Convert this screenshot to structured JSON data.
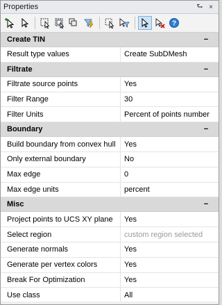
{
  "window": {
    "title": "Properties",
    "pin_glyph": "⮑",
    "close_glyph": "×"
  },
  "toolbar": {
    "tools": [
      {
        "name": "add-select-icon"
      },
      {
        "name": "select-icon"
      },
      {
        "name": "select-window-icon"
      },
      {
        "name": "select-crossing-icon"
      },
      {
        "name": "quick-select-icon"
      },
      {
        "name": "lightning-filter-icon"
      },
      {
        "name": "pick-move-icon"
      },
      {
        "name": "pick-filter-icon"
      },
      {
        "name": "pick-cursor-icon",
        "active": true
      },
      {
        "name": "deselect-icon"
      },
      {
        "name": "help-icon"
      }
    ]
  },
  "sections": [
    {
      "name": "Create TIN",
      "collapse": "−",
      "rows": [
        {
          "label": "Result type values",
          "value": "Create SubDMesh"
        }
      ]
    },
    {
      "name": "Filtrate",
      "collapse": "−",
      "rows": [
        {
          "label": "Filtrate source points",
          "value": "Yes"
        },
        {
          "label": "Filter Range",
          "value": "30"
        },
        {
          "label": "Filter Units",
          "value": "Percent of points number"
        }
      ]
    },
    {
      "name": "Boundary",
      "collapse": "−",
      "rows": [
        {
          "label": "Build boundary from convex hull",
          "value": "Yes"
        },
        {
          "label": "Only external boundary",
          "value": "No"
        },
        {
          "label": "Max edge",
          "value": "0"
        },
        {
          "label": "Max edge units",
          "value": "percent"
        }
      ]
    },
    {
      "name": "Misc",
      "collapse": "−",
      "rows": [
        {
          "label": "Project points to UCS XY plane",
          "value": "Yes"
        },
        {
          "label": "Select region",
          "value": "custom region selected",
          "muted": true
        },
        {
          "label": "Generate normals",
          "value": "Yes"
        },
        {
          "label": "Generate per vertex colors",
          "value": "Yes"
        },
        {
          "label": "Break For Optimization",
          "value": "Yes"
        },
        {
          "label": "Use class",
          "value": "All"
        }
      ]
    }
  ],
  "colors": {
    "section_bg": "#d9d9d9",
    "active_tool": "#cde4f7",
    "muted_text": "#9a9a9a"
  }
}
